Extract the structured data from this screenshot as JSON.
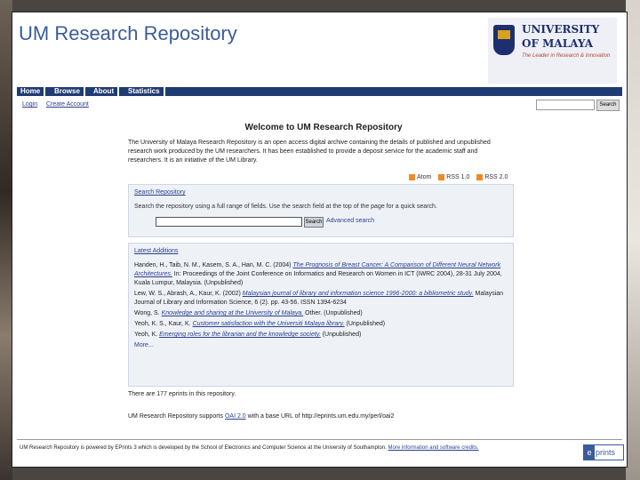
{
  "site": {
    "title": "UM Research Repository"
  },
  "logo": {
    "line1": "UNIVERSITY",
    "line2": "OF MALAYA",
    "tagline": "The Leader in Research & Innovation"
  },
  "nav": [
    "Home",
    "Browse",
    "About",
    "Statistics"
  ],
  "login": {
    "login": "Login",
    "create": "Create Account",
    "search_button": "Search"
  },
  "welcome": "Welcome to UM Research Repository",
  "intro": "The University of Malaya Research Repository is an open access digital archive containing the details of published and unpublished research work produced by the UM researchers. It has been established to provide a deposit service for the academic staff and researchers. It is an initiative of the UM Library.",
  "feeds": [
    "Atom",
    "RSS 1.0",
    "RSS 2.0"
  ],
  "search_box": {
    "heading": "Search Repository",
    "description": "Search the repository using a full range of fields. Use the search field at the top of the page for a quick search.",
    "button": "Search",
    "advanced": "Advanced search"
  },
  "latest": {
    "heading": "Latest Additions",
    "items": [
      {
        "authors": "Handen, H., Taib, N. M., Kasem, S. A., Han, M. C. (2004)",
        "title": "The Prognosis of Breast Cancer: A Comparison of Different Neural Network Architectures.",
        "rest": "In: Proceedings of the Joint Conference on Informatics and Research on Women in ICT (IWRC 2004), 28-31 July 2004, Kuala Lumpur, Malaysia. (Unpublished)"
      },
      {
        "authors": "Lew, W. S., Abrash, A., Kaur, K. (2002)",
        "title": "Malaysian journal of library and information science 1996-2000: a bibliometric study.",
        "rest": "Malaysian Journal of Library and Information Science, 6 (2). pp. 43-56. ISSN 1394-6234"
      },
      {
        "authors": "Wong, S.",
        "title": "Knowledge and sharing at the University of Malaya.",
        "rest": "Other. (Unpublished)"
      },
      {
        "authors": "Yeoh, K. S., Kaur, K.",
        "title": "Customer satisfaction with the Universiti Malaya library.",
        "rest": "(Unpublished)"
      },
      {
        "authors": "Yeoh, K.",
        "title": "Emerging roles for the librarian and the knowledge society.",
        "rest": "(Unpublished)"
      }
    ],
    "more": "More..."
  },
  "count_text": "There are 177 eprints in this repository.",
  "oai": {
    "prefix": "UM Research Repository supports",
    "link": "OAI 2.0",
    "suffix": "with a base URL of http://eprints.um.edu.my/perl/oai2"
  },
  "footer": {
    "text": "UM Research Repository is powered by EPrints 3 which is developed by the School of Electronics and Computer Science at the University of Southampton.",
    "link": "More information and software credits."
  },
  "eprints_logo": "prints",
  "colors": {
    "nav": "#1f3b73",
    "link": "#2a3f8f",
    "title": "#3a5c9a"
  }
}
